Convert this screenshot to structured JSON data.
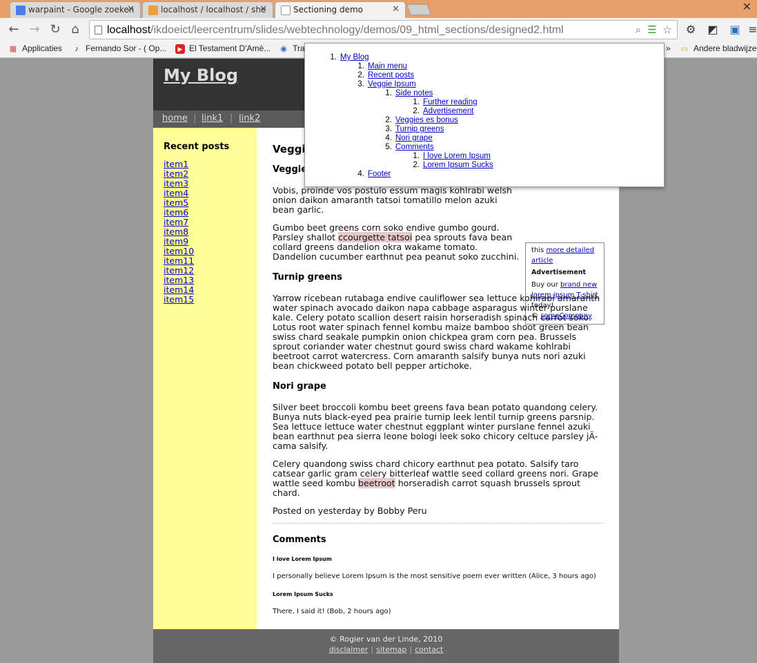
{
  "browser": {
    "tabs": [
      {
        "title": "warpaint - Google zoeken",
        "favicon_color": "#4a7fe8"
      },
      {
        "title": "localhost / localhost / she",
        "favicon_color": "#e8a040"
      },
      {
        "title": "Sectioning demo",
        "favicon_color": "#ffffff"
      }
    ],
    "url_host": "localhost",
    "url_path": "/ikdoeict/leercentrum/slides/webtechnology/demos/09_html_sections/designed2.html",
    "bookmarks": [
      {
        "label": "Applicaties",
        "icon": "apps-grid-icon"
      },
      {
        "label": "Fernando Sor - ( Op...",
        "icon": "guitar-icon"
      },
      {
        "label": "El Testament D'Amè...",
        "icon": "youtube-icon"
      },
      {
        "label": "Tra",
        "icon": "globe-icon"
      },
      {
        "label": "»",
        "icon": ""
      },
      {
        "label": "Andere bladwijze",
        "icon": "folder-icon"
      }
    ]
  },
  "site": {
    "title": "My Blog",
    "nav": [
      "home",
      "link1",
      "link2"
    ],
    "sidebar_title": "Recent posts",
    "sidebar_items": [
      "item1",
      "item2",
      "item3",
      "item4",
      "item5",
      "item6",
      "item7",
      "item8",
      "item9",
      "item10",
      "item11",
      "item12",
      "item13",
      "item14",
      "item15"
    ],
    "article_title": "Veggie",
    "section1_title": "Veggies",
    "p1": "Vobis, proinde vos postulo essum magis kohlrabi welsh onion daikon amaranth tatsoi tomatillo melon azuki bean garlic.",
    "p2_a": "Gumbo beet greens corn soko endive gumbo gourd. Parsley shallot ",
    "p2_hl": "ccourgette tatsoi",
    "p2_b": " pea sprouts fava bean collard greens dandelion okra wakame tomato. Dandelion cucumber earthnut pea peanut soko zucchini.",
    "aside_text_a": "this ",
    "aside_link1": "more detailed article",
    "aside_ad_title": "Advertisement",
    "aside_ad_a": "Buy our ",
    "aside_ad_link": "brand new lorem ipsum T-shirt",
    "aside_ad_b": " today!",
    "aside_copy_symbol": "© ",
    "aside_company": "someCompany",
    "section2_title": "Turnip greens",
    "p3": "Yarrow ricebean rutabaga endive cauliflower sea lettuce kohlrabi amaranth water spinach avocado daikon napa cabbage asparagus winter purslane kale. Celery potato scallion desert raisin horseradish spinach carrot soko. Lotus root water spinach fennel kombu maize bamboo shoot green bean swiss chard seakale pumpkin onion chickpea gram corn pea. Brussels sprout coriander water chestnut gourd swiss chard wakame kohlrabi beetroot carrot watercress. Corn amaranth salsify bunya nuts nori azuki bean chickweed potato bell pepper artichoke.",
    "section3_title": "Nori grape",
    "p4": "Silver beet broccoli kombu beet greens fava bean potato quandong celery. Bunya nuts black-eyed pea prairie turnip leek lentil turnip greens parsnip. Sea lettuce lettuce water chestnut eggplant winter purslane fennel azuki bean earthnut pea sierra leone bologi leek soko chicory celtuce parsley jÃ­cama salsify.",
    "p5_a": "Celery quandong swiss chard chicory earthnut pea potato. Salsify taro catsear garlic gram celery bitterleaf wattle seed collard greens nori. Grape wattle seed kombu ",
    "p5_hl": "beetroot",
    "p5_b": " horseradish carrot squash brussels sprout chard.",
    "posted": "Posted on yesterday by Bobby Peru",
    "comments_title": "Comments",
    "comment1_title": "I love Lorem Ipsum",
    "comment1_text": "I personally believe Lorem Ipsum is the most sensitive poem ever written (Alice, 3 hours ago)",
    "comment2_title": "Lorem Ipsum Sucks",
    "comment2_text": "There, I said it! (Bob, 2 hours ago)",
    "footer_copy": "© Rogier van der Linde, 2010",
    "footer_links": [
      "disclaimer",
      "sitemap",
      "contact"
    ]
  },
  "outline": [
    {
      "num": "1.",
      "label": "My Blog",
      "level": 0
    },
    {
      "num": "1.",
      "label": "Main menu",
      "level": 1
    },
    {
      "num": "2.",
      "label": "Recent posts",
      "level": 1
    },
    {
      "num": "3.",
      "label": "Veggie Ipsum",
      "level": 1
    },
    {
      "num": "1.",
      "label": "Side notes",
      "level": 2
    },
    {
      "num": "1.",
      "label": "Further reading",
      "level": 3
    },
    {
      "num": "2.",
      "label": "Advertisement",
      "level": 3
    },
    {
      "num": "2.",
      "label": "Veggies es bonus",
      "level": 2
    },
    {
      "num": "3.",
      "label": "Turnip greens",
      "level": 2
    },
    {
      "num": "4.",
      "label": "Nori grape",
      "level": 2
    },
    {
      "num": "5.",
      "label": "Comments",
      "level": 2
    },
    {
      "num": "1.",
      "label": "I love Lorem Ipsum",
      "level": 3
    },
    {
      "num": "2.",
      "label": "Lorem Ipsum Sucks",
      "level": 3
    },
    {
      "num": "4.",
      "label": "Footer",
      "level": 1
    }
  ]
}
